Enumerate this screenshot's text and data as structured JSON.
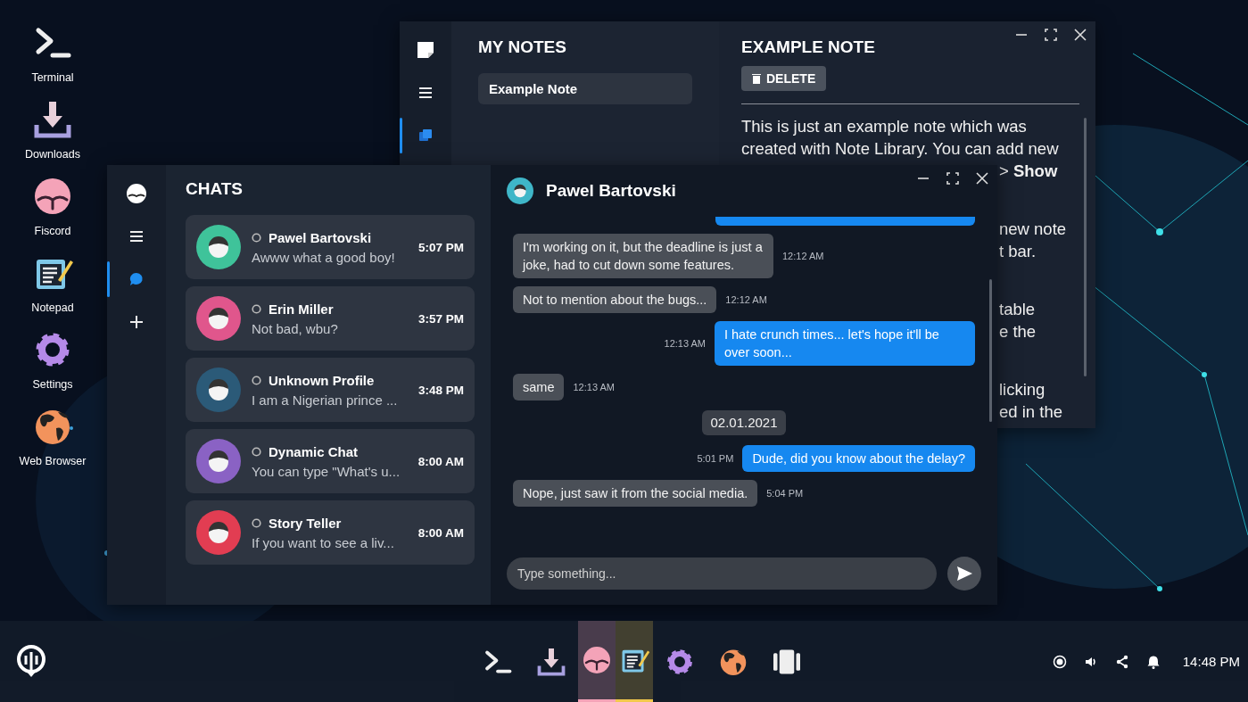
{
  "desktop_icons": [
    {
      "label": "Terminal",
      "kind": "terminal"
    },
    {
      "label": "Downloads",
      "kind": "download"
    },
    {
      "label": "Fiscord",
      "kind": "fiscord"
    },
    {
      "label": "Notepad",
      "kind": "notepad"
    },
    {
      "label": "Settings",
      "kind": "settings"
    },
    {
      "label": "Web Browser",
      "kind": "globe"
    }
  ],
  "notes_window": {
    "title": "MY NOTES",
    "sidebar": [
      {
        "kind": "menu",
        "selected": false
      },
      {
        "kind": "notes",
        "selected": true
      }
    ],
    "notes": [
      {
        "title": "Example Note",
        "selected": true
      }
    ],
    "note": {
      "title": "EXAMPLE NOTE",
      "delete_label": "DELETE",
      "paragraphs": [
        {
          "lines": [
            {
              "kind": "full",
              "text": "This is just an example note which was"
            },
            {
              "kind": "full",
              "text": "created with Note Library. You can add new"
            },
            {
              "kind": "tail",
              "text": "> **Show**"
            }
          ]
        },
        {
          "lines": [
            {
              "kind": "tail",
              "text": "new note"
            },
            {
              "kind": "tail",
              "text": "t bar."
            }
          ]
        },
        {
          "lines": [
            {
              "kind": "tail",
              "text": "table"
            },
            {
              "kind": "tail",
              "text": "e the"
            }
          ]
        },
        {
          "lines": [
            {
              "kind": "tail",
              "text": "licking"
            },
            {
              "kind": "tail",
              "text": "ed in the"
            }
          ]
        }
      ]
    }
  },
  "chat_window": {
    "title": "CHATS",
    "sidebar": [
      {
        "kind": "menu",
        "selected": false
      },
      {
        "kind": "chat",
        "selected": true
      },
      {
        "kind": "add",
        "selected": false
      }
    ],
    "chats": [
      {
        "name": "Pawel Bartovski",
        "preview": "Awww what a good boy!",
        "time": "5:07 PM",
        "color": "#3fc39a"
      },
      {
        "name": "Erin Miller",
        "preview": "Not bad, wbu?",
        "time": "3:57 PM",
        "color": "#e0568c"
      },
      {
        "name": "Unknown Profile",
        "preview": "I am a Nigerian prince ...",
        "time": "3:48 PM",
        "color": "#2b5a78"
      },
      {
        "name": "Dynamic Chat",
        "preview": "You can type \"What's u...",
        "time": "8:00 AM",
        "color": "#8a62c4"
      },
      {
        "name": "Story Teller",
        "preview": "If you want to see a liv...",
        "time": "8:00 AM",
        "color": "#e23d52"
      }
    ],
    "conversation": {
      "name": "Pawel Bartovski",
      "color": "#3fb6c8",
      "messages": [
        {
          "kind": "in",
          "text": "I'm working on it, but the deadline is just a joke, had to cut down some features.",
          "time": "12:12 AM"
        },
        {
          "kind": "in",
          "text": "Not to mention about the bugs...",
          "time": "12:12 AM"
        },
        {
          "kind": "out",
          "text": "I hate crunch times... let's hope it'll be over soon...",
          "time": "12:13 AM"
        },
        {
          "kind": "in",
          "text": "same",
          "time": "12:13 AM"
        },
        {
          "kind": "date",
          "text": "02.01.2021"
        },
        {
          "kind": "out",
          "text": "Dude, did you know about the delay?",
          "time": "5:01 PM"
        },
        {
          "kind": "in",
          "text": "Nope, just saw it from the social media.",
          "time": "5:04 PM"
        }
      ],
      "placeholder": "Type something..."
    }
  },
  "taskbar": {
    "apps": [
      {
        "kind": "terminal",
        "open": false
      },
      {
        "kind": "download",
        "open": false
      },
      {
        "kind": "fiscord",
        "open": true
      },
      {
        "kind": "notepad",
        "open": true
      },
      {
        "kind": "settings",
        "open": false
      },
      {
        "kind": "globe",
        "open": false
      },
      {
        "kind": "widget",
        "open": false
      }
    ],
    "clock": "14:48 PM"
  }
}
